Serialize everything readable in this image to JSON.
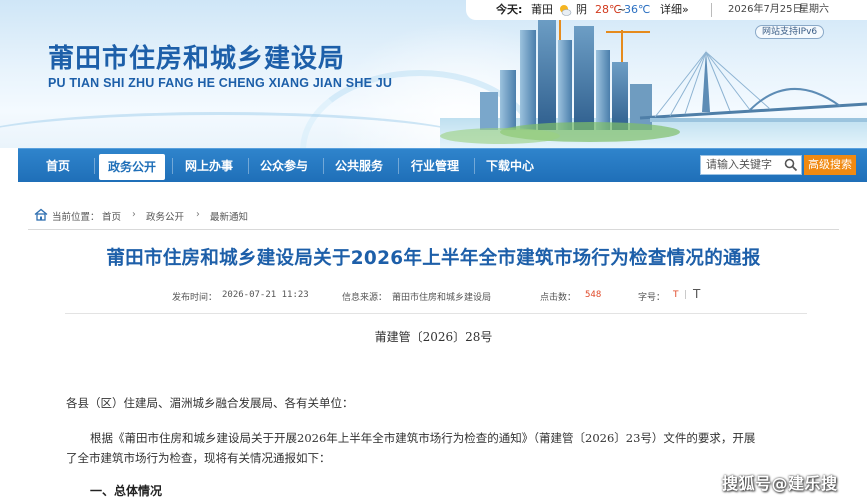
{
  "header": {
    "site_title": "莆田市住房和城乡建设局",
    "site_subtitle": "PU TIAN SHI ZHU FANG HE CHENG XIANG JIAN SHE JU"
  },
  "weather": {
    "today_label": "今天:",
    "city": "莆田",
    "condition": "阴",
    "temp_high": "28℃",
    "tilde": "~",
    "temp_low": "36℃",
    "detail_link": "详细»",
    "date": "2026年7月25日",
    "weekday": "星期六",
    "icon": "partly-cloudy-icon"
  },
  "ipv6_badge": "网站支持IPv6",
  "nav": {
    "items": [
      {
        "label": "首页"
      },
      {
        "label": "政务公开"
      },
      {
        "label": "网上办事"
      },
      {
        "label": "公众参与"
      },
      {
        "label": "公共服务"
      },
      {
        "label": "行业管理"
      },
      {
        "label": "下载中心"
      }
    ],
    "active_index": 1,
    "search_placeholder": "请输入关键字",
    "advanced_search": "高级搜索"
  },
  "breadcrumb": {
    "prefix": "当前位置：",
    "items": [
      "首页",
      "政务公开",
      "最新通知"
    ],
    "arrow": "›"
  },
  "article": {
    "title": "莆田市住房和城乡建设局关于2026年上半年全市建筑市场行为检查情况的通报",
    "meta": {
      "publish_label": "发布时间：",
      "publish_time": "2026-07-21 11:23",
      "source_label": "信息来源：",
      "source": "莆田市住房和城乡建设局",
      "clicks_label": "点击数：",
      "clicks": "548",
      "font_label": "字号：",
      "font_small": "T",
      "font_sep": "|",
      "font_large": "T"
    },
    "doc_number": "莆建管〔2026〕28号",
    "salutation": "各县（区）住建局、湄洲城乡融合发展局、各有关单位：",
    "body_line1": "根据《莆田市住房和城乡建设局关于开展2026年上半年全市建筑市场行为检查的通知》（莆建管〔2026〕23号）文件的要求，开展",
    "body_line2": "了全市建筑市场行为检查，现将有关情况通报如下：",
    "section1": "一、总体情况"
  },
  "watermark": "搜狐号@建乐搜",
  "colors": {
    "brand_blue": "#1d5fa9",
    "nav_blue": "#1f6fb8",
    "accent_orange": "#f08a12",
    "hit_red": "#e04a2a"
  }
}
